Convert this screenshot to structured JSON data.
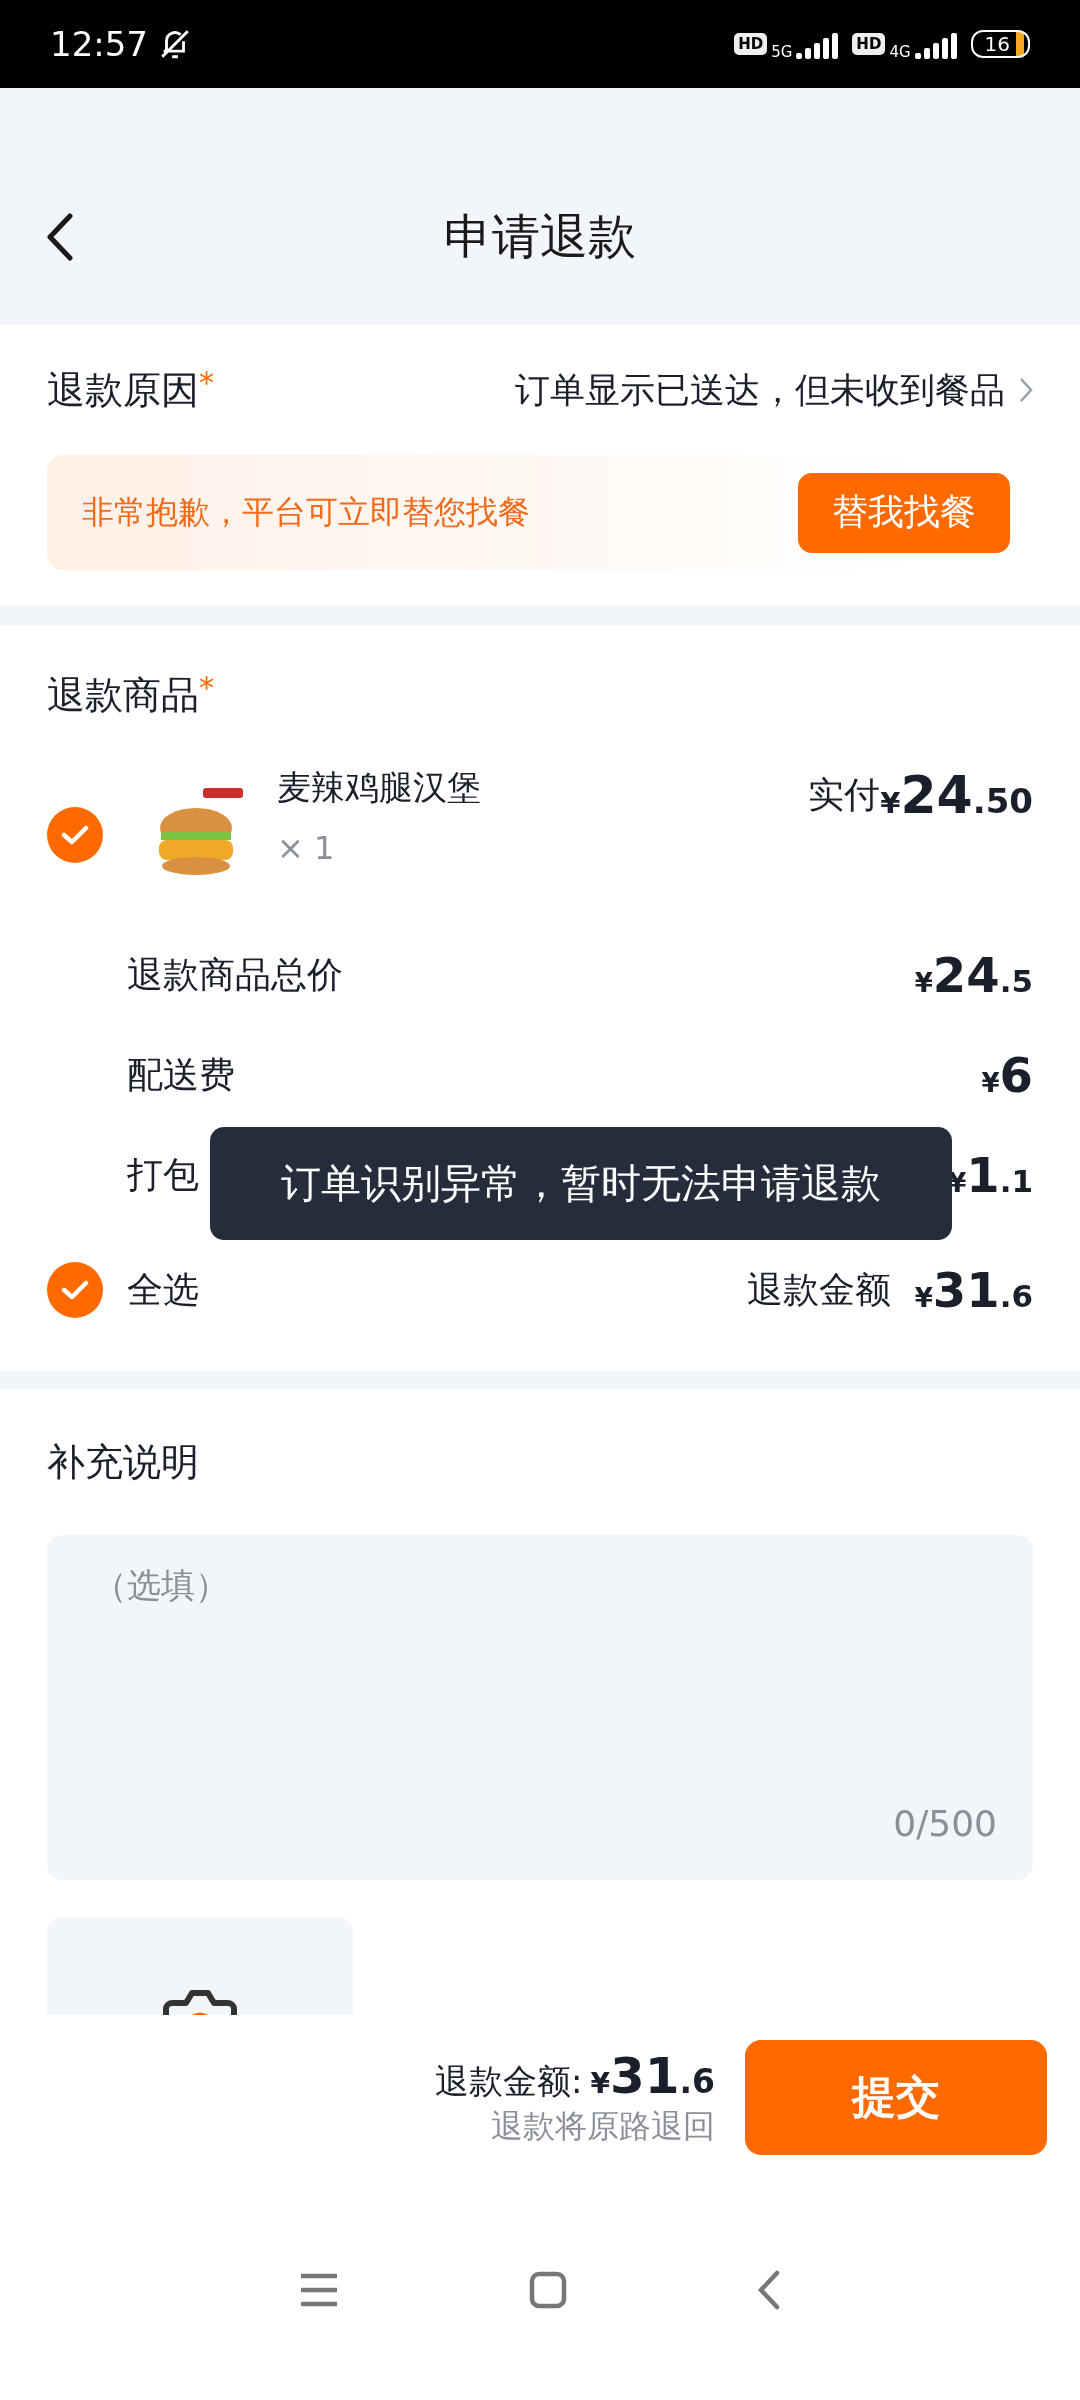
{
  "status_bar": {
    "time": "12:57",
    "sims": [
      {
        "hd": "HD",
        "network": "5G"
      },
      {
        "hd": "HD",
        "network": "4G"
      }
    ],
    "battery": "16"
  },
  "header": {
    "title": "申请退款"
  },
  "refund_reason": {
    "label": "退款原因",
    "required_mark": "*",
    "value": "订单显示已送达，但未收到餐品"
  },
  "banner": {
    "message": "非常抱歉，平台可立即替您找餐",
    "button": "替我找餐"
  },
  "refund_items": {
    "label": "退款商品",
    "required_mark": "*",
    "items": [
      {
        "name": "麦辣鸡腿汉堡",
        "quantity": "× 1",
        "paid_label": "实付",
        "paid_amount": "¥24.50",
        "checked": true
      }
    ],
    "fees": [
      {
        "label": "退款商品总价",
        "amount": "¥24.5"
      },
      {
        "label": "配送费",
        "amount": "¥6"
      },
      {
        "label": "打包",
        "amount": "¥1.1"
      }
    ],
    "select_all": {
      "label": "全选",
      "checked": true,
      "total_label": "退款金额",
      "total_amount": "¥31.6"
    }
  },
  "toast": {
    "message": "订单识别异常，暂时无法申请退款"
  },
  "notes": {
    "label": "补充说明",
    "placeholder": "（选填）",
    "counter": "0/500"
  },
  "footer": {
    "total_label": "退款金额:",
    "total_amount": "¥31.6",
    "hint": "退款将原路退回",
    "submit": "提交"
  }
}
